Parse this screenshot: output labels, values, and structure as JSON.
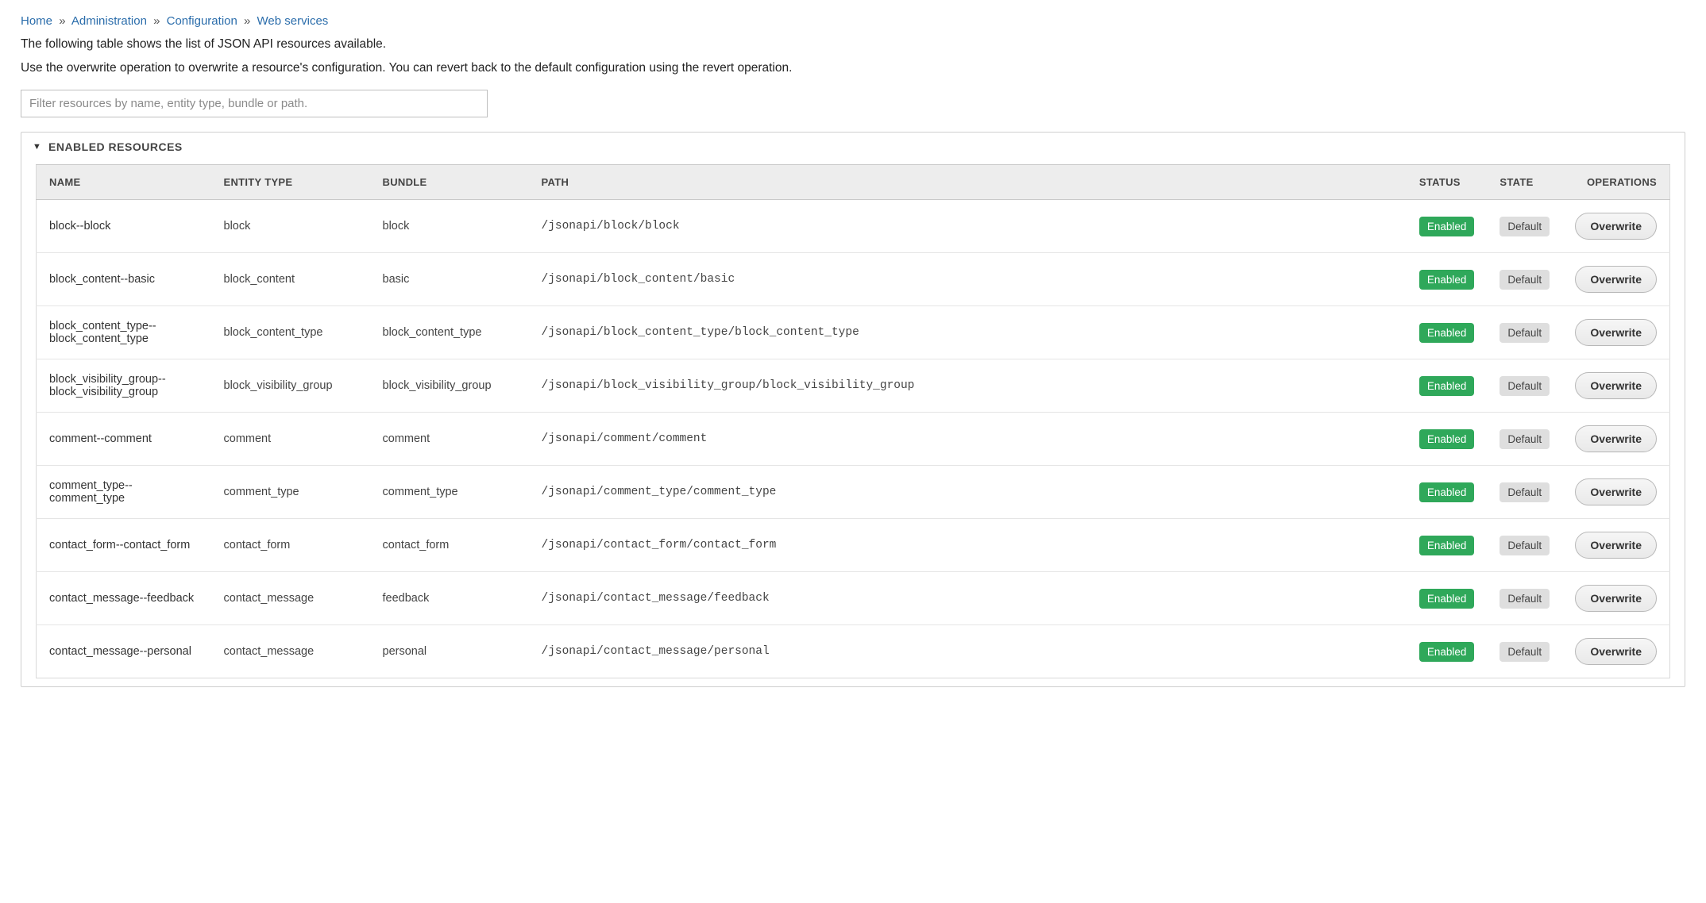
{
  "breadcrumb": {
    "items": [
      {
        "label": "Home"
      },
      {
        "label": "Administration"
      },
      {
        "label": "Configuration"
      },
      {
        "label": "Web services"
      }
    ],
    "separator": "»"
  },
  "intro": {
    "line1": "The following table shows the list of JSON API resources available.",
    "line2": "Use the overwrite operation to overwrite a resource's configuration. You can revert back to the default configuration using the revert operation."
  },
  "filter": {
    "placeholder": "Filter resources by name, entity type, bundle or path.",
    "value": ""
  },
  "panel": {
    "title": "ENABLED RESOURCES"
  },
  "columns": {
    "name": "NAME",
    "entity_type": "ENTITY TYPE",
    "bundle": "BUNDLE",
    "path": "PATH",
    "status": "STATUS",
    "state": "STATE",
    "operations": "OPERATIONS"
  },
  "labels": {
    "status_enabled": "Enabled",
    "state_default": "Default",
    "op_overwrite": "Overwrite"
  },
  "rows": [
    {
      "name": "block--block",
      "entity_type": "block",
      "bundle": "block",
      "path": "/jsonapi/block/block"
    },
    {
      "name": "block_content--basic",
      "entity_type": "block_content",
      "bundle": "basic",
      "path": "/jsonapi/block_content/basic"
    },
    {
      "name": "block_content_type--block_content_type",
      "entity_type": "block_content_type",
      "bundle": "block_content_type",
      "path": "/jsonapi/block_content_type/block_content_type"
    },
    {
      "name": "block_visibility_group--block_visibility_group",
      "entity_type": "block_visibility_group",
      "bundle": "block_visibility_group",
      "path": "/jsonapi/block_visibility_group/block_visibility_group"
    },
    {
      "name": "comment--comment",
      "entity_type": "comment",
      "bundle": "comment",
      "path": "/jsonapi/comment/comment"
    },
    {
      "name": "comment_type--comment_type",
      "entity_type": "comment_type",
      "bundle": "comment_type",
      "path": "/jsonapi/comment_type/comment_type"
    },
    {
      "name": "contact_form--contact_form",
      "entity_type": "contact_form",
      "bundle": "contact_form",
      "path": "/jsonapi/contact_form/contact_form"
    },
    {
      "name": "contact_message--feedback",
      "entity_type": "contact_message",
      "bundle": "feedback",
      "path": "/jsonapi/contact_message/feedback"
    },
    {
      "name": "contact_message--personal",
      "entity_type": "contact_message",
      "bundle": "personal",
      "path": "/jsonapi/contact_message/personal"
    }
  ]
}
